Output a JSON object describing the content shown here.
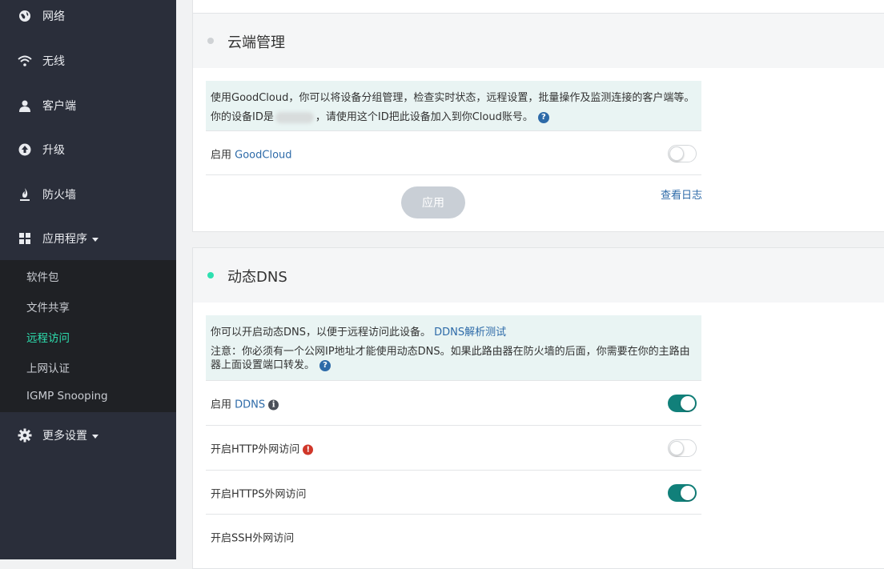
{
  "sidebar": {
    "items": [
      {
        "label": "网络",
        "icon": "globe-icon"
      },
      {
        "label": "无线",
        "icon": "wifi-icon"
      },
      {
        "label": "客户端",
        "icon": "user-icon"
      },
      {
        "label": "升级",
        "icon": "upgrade-icon"
      },
      {
        "label": "防火墙",
        "icon": "fire-icon"
      },
      {
        "label": "应用程序",
        "icon": "apps-grid-icon"
      },
      {
        "label": "更多设置",
        "icon": "gear-icon"
      }
    ],
    "submenu": [
      "软件包",
      "文件共享",
      "远程访问",
      "上网认证",
      "IGMP Snooping"
    ],
    "active_submenu": "远程访问",
    "active_color": "#2ee0b0"
  },
  "cloud": {
    "title": "云端管理",
    "status_color": "#cfd2d5",
    "info_line1": "使用GoodCloud，你可以将设备分组管理，检查实时状态，远程设置，批量操作及监测连接的客户端等。",
    "info_line2_prefix": "你的设备ID是",
    "info_line2_suffix": "，请使用这个ID把此设备加入到你Cloud账号。",
    "enable_prefix": "启用 ",
    "enable_link": "GoodCloud",
    "enabled": false,
    "apply_label": "应用",
    "log_link": "查看日志"
  },
  "ddns": {
    "title": "动态DNS",
    "status_color": "#2ee0b0",
    "info_line1": "你可以开启动态DNS，以便于远程访问此设备。",
    "info_link": "DDNS解析测试",
    "info_line2": "注意：你必须有一个公网IP地址才能使用动态DNS。如果此路由器在防火墙的后面，你需要在你的主路由",
    "info_line3": "器上面设置端口转发。",
    "rows": [
      {
        "prefix": "启用 ",
        "link": "DDNS",
        "on": true
      },
      {
        "label": "开启HTTP外网访问",
        "on": false
      },
      {
        "label": "开启HTTPS外网访问",
        "on": true
      },
      {
        "label": "开启SSH外网访问"
      }
    ],
    "toggle_on_color": "#11807a"
  }
}
